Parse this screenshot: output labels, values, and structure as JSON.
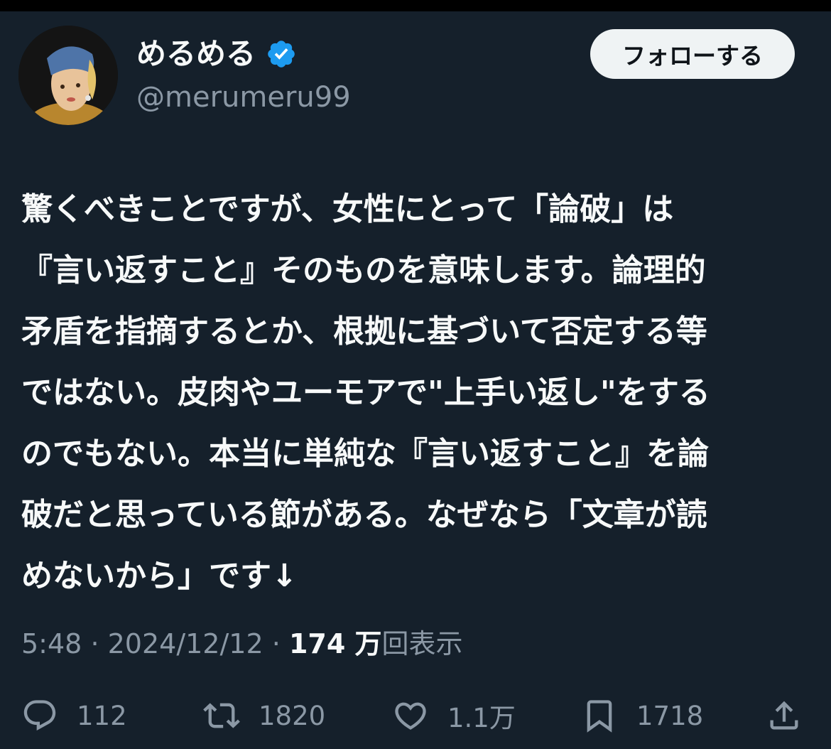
{
  "author": {
    "display_name": "めるめる",
    "handle": "@merumeru99",
    "verified_icon": "verified-badge-icon",
    "avatar": "girl-with-pearl-earring-avatar"
  },
  "follow_button": {
    "label": "フォローする"
  },
  "tweet": {
    "lines": [
      "驚くべきことですが、女性にとって「論破」は",
      "『言い返すこと』そのものを意味します。論理的",
      "矛盾を指摘するとか、根拠に基づいて否定する等",
      "ではない。皮肉やユーモアで\"上手い返し\"をする",
      "のでもない。本当に単純な『言い返すこと』を論",
      "破だと思っている節がある。なぜなら「文章が読",
      "めないから」です↓"
    ]
  },
  "meta": {
    "time": "5:48",
    "separator": "·",
    "date": "2024/12/12",
    "views_number": "174 万",
    "views_label": "回表示"
  },
  "actions": {
    "reply_count": "112",
    "retweet_count": "1820",
    "like_count": "1.1万",
    "bookmark_count": "1718"
  },
  "colors": {
    "background": "#15202b",
    "text": "#f7f9f9",
    "secondary": "#8b98a5",
    "verified": "#1d9bf0"
  }
}
